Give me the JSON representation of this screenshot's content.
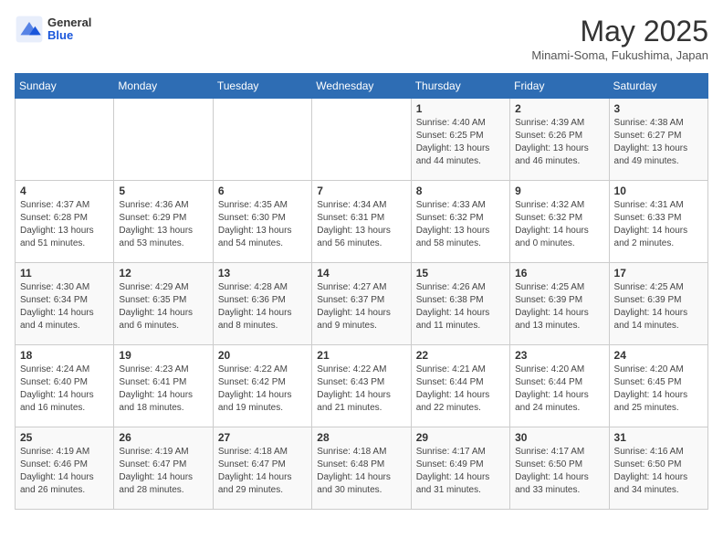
{
  "header": {
    "logo_general": "General",
    "logo_blue": "Blue",
    "title": "May 2025",
    "subtitle": "Minami-Soma, Fukushima, Japan"
  },
  "weekdays": [
    "Sunday",
    "Monday",
    "Tuesday",
    "Wednesday",
    "Thursday",
    "Friday",
    "Saturday"
  ],
  "weeks": [
    [
      {
        "day": "",
        "content": ""
      },
      {
        "day": "",
        "content": ""
      },
      {
        "day": "",
        "content": ""
      },
      {
        "day": "",
        "content": ""
      },
      {
        "day": "1",
        "content": "Sunrise: 4:40 AM\nSunset: 6:25 PM\nDaylight: 13 hours\nand 44 minutes."
      },
      {
        "day": "2",
        "content": "Sunrise: 4:39 AM\nSunset: 6:26 PM\nDaylight: 13 hours\nand 46 minutes."
      },
      {
        "day": "3",
        "content": "Sunrise: 4:38 AM\nSunset: 6:27 PM\nDaylight: 13 hours\nand 49 minutes."
      }
    ],
    [
      {
        "day": "4",
        "content": "Sunrise: 4:37 AM\nSunset: 6:28 PM\nDaylight: 13 hours\nand 51 minutes."
      },
      {
        "day": "5",
        "content": "Sunrise: 4:36 AM\nSunset: 6:29 PM\nDaylight: 13 hours\nand 53 minutes."
      },
      {
        "day": "6",
        "content": "Sunrise: 4:35 AM\nSunset: 6:30 PM\nDaylight: 13 hours\nand 54 minutes."
      },
      {
        "day": "7",
        "content": "Sunrise: 4:34 AM\nSunset: 6:31 PM\nDaylight: 13 hours\nand 56 minutes."
      },
      {
        "day": "8",
        "content": "Sunrise: 4:33 AM\nSunset: 6:32 PM\nDaylight: 13 hours\nand 58 minutes."
      },
      {
        "day": "9",
        "content": "Sunrise: 4:32 AM\nSunset: 6:32 PM\nDaylight: 14 hours\nand 0 minutes."
      },
      {
        "day": "10",
        "content": "Sunrise: 4:31 AM\nSunset: 6:33 PM\nDaylight: 14 hours\nand 2 minutes."
      }
    ],
    [
      {
        "day": "11",
        "content": "Sunrise: 4:30 AM\nSunset: 6:34 PM\nDaylight: 14 hours\nand 4 minutes."
      },
      {
        "day": "12",
        "content": "Sunrise: 4:29 AM\nSunset: 6:35 PM\nDaylight: 14 hours\nand 6 minutes."
      },
      {
        "day": "13",
        "content": "Sunrise: 4:28 AM\nSunset: 6:36 PM\nDaylight: 14 hours\nand 8 minutes."
      },
      {
        "day": "14",
        "content": "Sunrise: 4:27 AM\nSunset: 6:37 PM\nDaylight: 14 hours\nand 9 minutes."
      },
      {
        "day": "15",
        "content": "Sunrise: 4:26 AM\nSunset: 6:38 PM\nDaylight: 14 hours\nand 11 minutes."
      },
      {
        "day": "16",
        "content": "Sunrise: 4:25 AM\nSunset: 6:39 PM\nDaylight: 14 hours\nand 13 minutes."
      },
      {
        "day": "17",
        "content": "Sunrise: 4:25 AM\nSunset: 6:39 PM\nDaylight: 14 hours\nand 14 minutes."
      }
    ],
    [
      {
        "day": "18",
        "content": "Sunrise: 4:24 AM\nSunset: 6:40 PM\nDaylight: 14 hours\nand 16 minutes."
      },
      {
        "day": "19",
        "content": "Sunrise: 4:23 AM\nSunset: 6:41 PM\nDaylight: 14 hours\nand 18 minutes."
      },
      {
        "day": "20",
        "content": "Sunrise: 4:22 AM\nSunset: 6:42 PM\nDaylight: 14 hours\nand 19 minutes."
      },
      {
        "day": "21",
        "content": "Sunrise: 4:22 AM\nSunset: 6:43 PM\nDaylight: 14 hours\nand 21 minutes."
      },
      {
        "day": "22",
        "content": "Sunrise: 4:21 AM\nSunset: 6:44 PM\nDaylight: 14 hours\nand 22 minutes."
      },
      {
        "day": "23",
        "content": "Sunrise: 4:20 AM\nSunset: 6:44 PM\nDaylight: 14 hours\nand 24 minutes."
      },
      {
        "day": "24",
        "content": "Sunrise: 4:20 AM\nSunset: 6:45 PM\nDaylight: 14 hours\nand 25 minutes."
      }
    ],
    [
      {
        "day": "25",
        "content": "Sunrise: 4:19 AM\nSunset: 6:46 PM\nDaylight: 14 hours\nand 26 minutes."
      },
      {
        "day": "26",
        "content": "Sunrise: 4:19 AM\nSunset: 6:47 PM\nDaylight: 14 hours\nand 28 minutes."
      },
      {
        "day": "27",
        "content": "Sunrise: 4:18 AM\nSunset: 6:47 PM\nDaylight: 14 hours\nand 29 minutes."
      },
      {
        "day": "28",
        "content": "Sunrise: 4:18 AM\nSunset: 6:48 PM\nDaylight: 14 hours\nand 30 minutes."
      },
      {
        "day": "29",
        "content": "Sunrise: 4:17 AM\nSunset: 6:49 PM\nDaylight: 14 hours\nand 31 minutes."
      },
      {
        "day": "30",
        "content": "Sunrise: 4:17 AM\nSunset: 6:50 PM\nDaylight: 14 hours\nand 33 minutes."
      },
      {
        "day": "31",
        "content": "Sunrise: 4:16 AM\nSunset: 6:50 PM\nDaylight: 14 hours\nand 34 minutes."
      }
    ]
  ]
}
